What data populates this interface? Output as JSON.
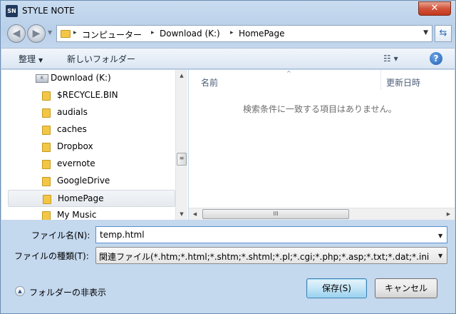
{
  "window": {
    "icon_text": "SN",
    "title": "STYLE NOTE",
    "close_glyph": "✕"
  },
  "address_bar": {
    "crumbs": [
      "コンピューター",
      "Download (K:)",
      "HomePage"
    ],
    "separator": "▸",
    "back_glyph": "◀",
    "forward_glyph": "▶"
  },
  "toolbar": {
    "organize_label": "整理",
    "new_folder_label": "新しいフォルダー",
    "view_glyph": "☷ ▾",
    "help_glyph": "?"
  },
  "nav_pane": {
    "drive_label": "Download (K:)",
    "drive_icon_text": "K",
    "folders": [
      "$RECYCLE.BIN",
      "audials",
      "caches",
      "Dropbox",
      "evernote",
      "GoogleDrive",
      "HomePage",
      "My Music"
    ],
    "selected_folder": "HomePage"
  },
  "file_list": {
    "columns": [
      "名前",
      "更新日時"
    ],
    "sort_indicator": "^",
    "empty_message": "検索条件に一致する項目はありません。"
  },
  "scrollbars": {
    "up": "▲",
    "down": "▼",
    "left": "◀",
    "right": "▶",
    "grip_v": "≡",
    "grip_h": "III"
  },
  "form": {
    "filename_label": "ファイル名(N):",
    "filename_value": "temp.html",
    "filetype_label": "ファイルの種類(T):",
    "filetype_value": "関連ファイル(*.htm;*.html;*.shtm;*.shtml;*.pl;*.cgi;*.php;*.asp;*.txt;*.dat;*.ini",
    "dropdown_glyph": "▼"
  },
  "footer": {
    "hide_folders_label": "フォルダーの非表示",
    "hide_folders_glyph": "▲",
    "save_label": "保存(S)",
    "cancel_label": "キャンセル"
  },
  "colors": {
    "frame": "#c4d8ee",
    "selected_item": "#e6eaef",
    "help": "#1f5fb0",
    "primary_button": "#98d1ef"
  }
}
